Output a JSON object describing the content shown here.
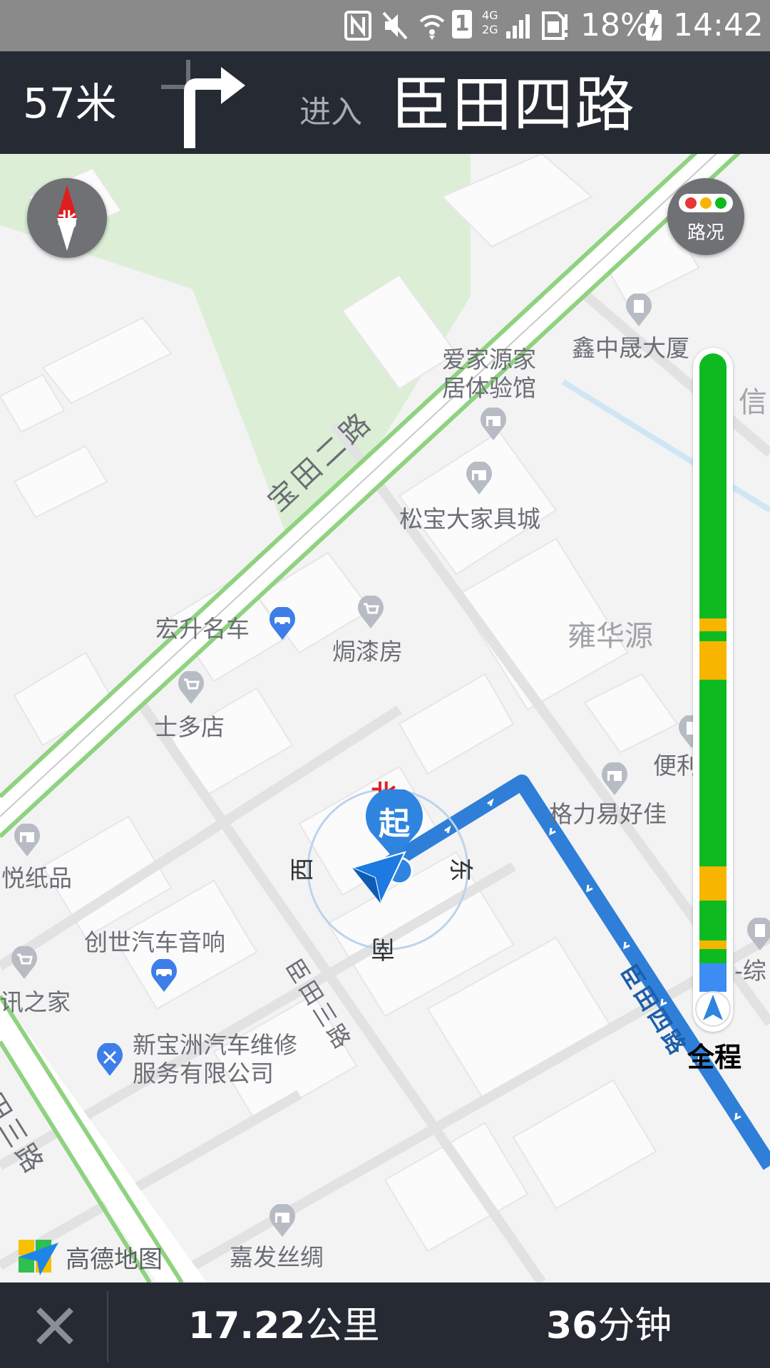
{
  "status_bar": {
    "battery_percent": "18%",
    "time": "14:42",
    "sim_slot": "1",
    "network": "4G 2G"
  },
  "navigation": {
    "distance_to_turn": "57米",
    "turn_icon": "turn-right-arrow-icon",
    "enter_label": "进入",
    "next_road": "臣田四路"
  },
  "map": {
    "compass_label": "北",
    "traffic_button_label": "路况",
    "roads": [
      "宝田二路",
      "臣田三路",
      "臣田四路",
      "宝田三路"
    ],
    "pois": [
      {
        "name": "爱家源家",
        "name2": "居体验馆",
        "icon": "shop-icon"
      },
      {
        "name": "鑫中晟大厦",
        "icon": "building-icon"
      },
      {
        "name": "信",
        "icon": ""
      },
      {
        "name": "松宝大家具城",
        "icon": "shop-icon"
      },
      {
        "name": "宏升名车",
        "icon": "car-icon"
      },
      {
        "name": "焗漆房",
        "icon": "cart-icon"
      },
      {
        "name": "雍华源",
        "icon": ""
      },
      {
        "name": "士多店",
        "icon": "cart-icon"
      },
      {
        "name": "便利",
        "icon": "building-icon"
      },
      {
        "name": "格力易好佳",
        "icon": "shop-icon"
      },
      {
        "name": "悦纸品",
        "icon": "shop-icon"
      },
      {
        "name": "创世汽车音响",
        "icon": "car-icon"
      },
      {
        "name": "讯之家",
        "icon": "cart-icon"
      },
      {
        "name": "新宝洲汽车维修",
        "name2": "服务有限公司",
        "icon": "wrench-icon"
      },
      {
        "name": "嘉发丝绸",
        "icon": "shop-icon"
      },
      {
        "name": "-综",
        "icon": "building-icon"
      }
    ],
    "direction_ring": {
      "north": "北",
      "east": "东",
      "south": "南",
      "west": "西"
    },
    "start_marker_label": "起",
    "logo_text": "高德地图"
  },
  "route_bar": {
    "overview_label": "全程",
    "segments": [
      "green",
      "yellow",
      "green",
      "yellow",
      "green",
      "blue"
    ],
    "colors": {
      "green": "#0dbb21",
      "yellow": "#f7b500",
      "blue": "#3c8cf3"
    }
  },
  "bottom_bar": {
    "remaining_distance_value": "17.22",
    "remaining_distance_unit": "公里",
    "remaining_time_value": "36",
    "remaining_time_unit": "分钟"
  },
  "colors": {
    "route": "#2f7fd8",
    "header_bg": "#262a33",
    "road_edge": "#8fd27f"
  }
}
